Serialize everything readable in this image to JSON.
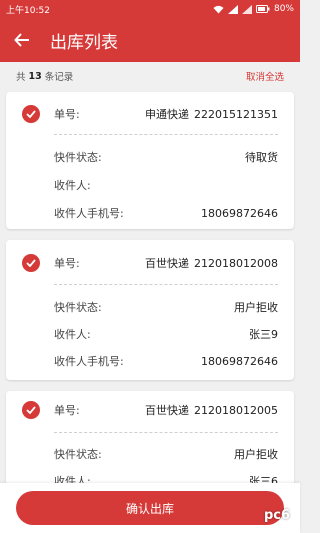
{
  "status_bar": {
    "time": "上午10:52",
    "battery": "80%"
  },
  "header": {
    "title": "出库列表"
  },
  "summary": {
    "prefix": "共",
    "count": "13",
    "suffix": "条记录",
    "cancel_all": "取消全选"
  },
  "labels": {
    "order_no": "单号:",
    "status": "快件状态:",
    "recipient": "收件人:",
    "phone": "收件人手机号:"
  },
  "orders": [
    {
      "courier": "申通快递",
      "number": "222015121351",
      "status": "待取货",
      "recipient": "",
      "phone": "18069872646",
      "selected": true
    },
    {
      "courier": "百世快递",
      "number": "212018012008",
      "status": "用户拒收",
      "recipient": "张三9",
      "phone": "18069872646",
      "selected": true
    },
    {
      "courier": "百世快递",
      "number": "212018012005",
      "status": "用户拒收",
      "recipient": "张三6",
      "phone": "",
      "selected": true
    }
  ],
  "footer": {
    "confirm_label": "确认出库"
  },
  "watermark": "pc6",
  "colors": {
    "primary": "#d63a38",
    "background": "#f0f0f0"
  }
}
